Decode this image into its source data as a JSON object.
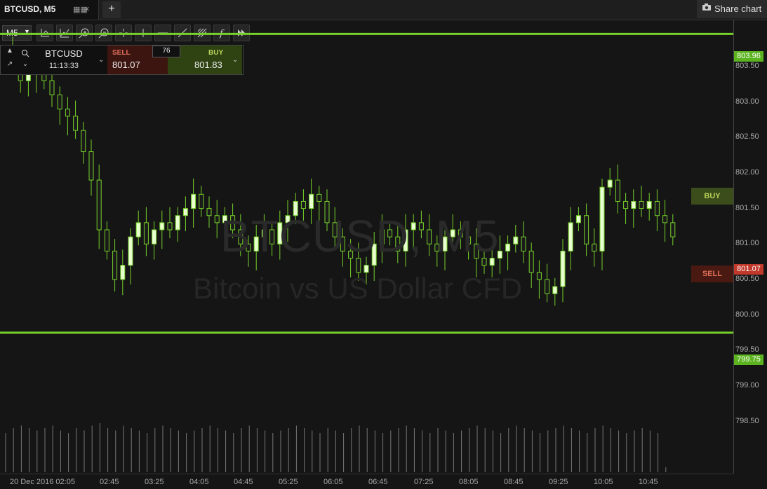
{
  "tab": {
    "title": "BTCUSD, M5",
    "grid_icon": "grid-icon",
    "close": "×",
    "new": "+"
  },
  "share": {
    "label": "Share chart",
    "icon": "camera-icon"
  },
  "toolbar": {
    "timeframe": "M5",
    "tools": [
      "axis-icon",
      "line-chart-icon",
      "zoom-in-icon",
      "zoom-out-icon",
      "crosshair-icon",
      "vertical-line-icon",
      "horizontal-line-icon",
      "trend-line-icon",
      "fib-icon",
      "function-icon",
      "forward-icon"
    ]
  },
  "panel": {
    "symbol": "BTCUSD",
    "time": "11:13:33",
    "sell_label": "SELL",
    "sell_price": "801.07",
    "spread": "76",
    "buy_label": "BUY",
    "buy_price": "801.83"
  },
  "watermark": {
    "symbol": "BTCUSD, M5",
    "name": "Bitcoin vs US Dollar CFD"
  },
  "markers": {
    "buy": "BUY",
    "sell": "SELL"
  },
  "levels": {
    "upper": "803.96",
    "lower": "799.75",
    "current": "801.07"
  },
  "colors": {
    "level_line": "#76d12a",
    "bull_candle": "#e8ffd0",
    "bear_candle": "#1a1a1a",
    "sell_tag": "#c0392b",
    "buy_marker": "#3b4d1a"
  },
  "chart_data": {
    "type": "candlestick",
    "y_ticks": [
      "803.50",
      "803.00",
      "802.50",
      "802.00",
      "801.50",
      "801.00",
      "800.50",
      "800.00",
      "799.50",
      "799.00",
      "798.50"
    ],
    "x_ticks": [
      "20 Dec 2016 02:05",
      "02:45",
      "03:25",
      "04:05",
      "04:45",
      "05:25",
      "06:05",
      "06:45",
      "07:25",
      "08:05",
      "08:45",
      "09:25",
      "10:05",
      "10:45"
    ],
    "ylim": [
      798.2,
      804.2
    ],
    "horizontal_levels": [
      803.96,
      799.75
    ],
    "close_series": [
      803.6,
      803.3,
      803.4,
      803.5,
      803.3,
      803.1,
      802.9,
      802.8,
      802.6,
      802.3,
      801.9,
      801.2,
      800.9,
      800.5,
      800.7,
      801.1,
      801.3,
      801.0,
      801.2,
      801.3,
      801.2,
      801.4,
      801.5,
      801.7,
      801.5,
      801.4,
      801.3,
      801.4,
      801.2,
      801.0,
      800.9,
      801.1,
      801.2,
      801.0,
      801.3,
      801.4,
      801.6,
      801.5,
      801.7,
      801.6,
      801.3,
      801.1,
      800.9,
      800.8,
      800.6,
      800.7,
      801.0,
      801.2,
      801.1,
      800.9,
      801.2,
      801.3,
      801.2,
      801.0,
      800.9,
      801.1,
      801.2,
      801.1,
      801.0,
      800.8,
      800.7,
      800.8,
      800.9,
      801.0,
      801.1,
      800.9,
      800.6,
      800.5,
      800.3,
      800.4,
      800.9,
      801.3,
      801.4,
      801.0,
      800.9,
      801.8,
      801.9,
      801.6,
      801.5,
      801.6,
      801.5,
      801.6,
      801.4,
      801.3,
      801.1
    ],
    "volume": [
      16,
      18,
      19,
      18,
      17,
      18,
      19,
      17,
      16,
      18,
      17,
      19,
      20,
      18,
      17,
      19,
      18,
      17,
      16,
      18,
      19,
      18,
      17,
      16,
      17,
      18,
      19,
      18,
      17,
      16,
      18,
      19,
      18,
      17,
      16,
      17,
      18,
      19,
      18,
      17,
      16,
      18,
      17,
      16,
      18,
      19,
      18,
      17,
      16,
      17,
      18,
      19,
      18,
      17,
      16,
      18,
      17,
      16,
      17,
      18,
      19,
      18,
      17,
      16,
      18,
      19,
      18,
      17,
      16,
      17,
      18,
      19,
      18,
      17,
      16,
      18,
      19,
      18,
      17,
      16,
      17,
      18,
      17,
      16,
      2
    ]
  }
}
